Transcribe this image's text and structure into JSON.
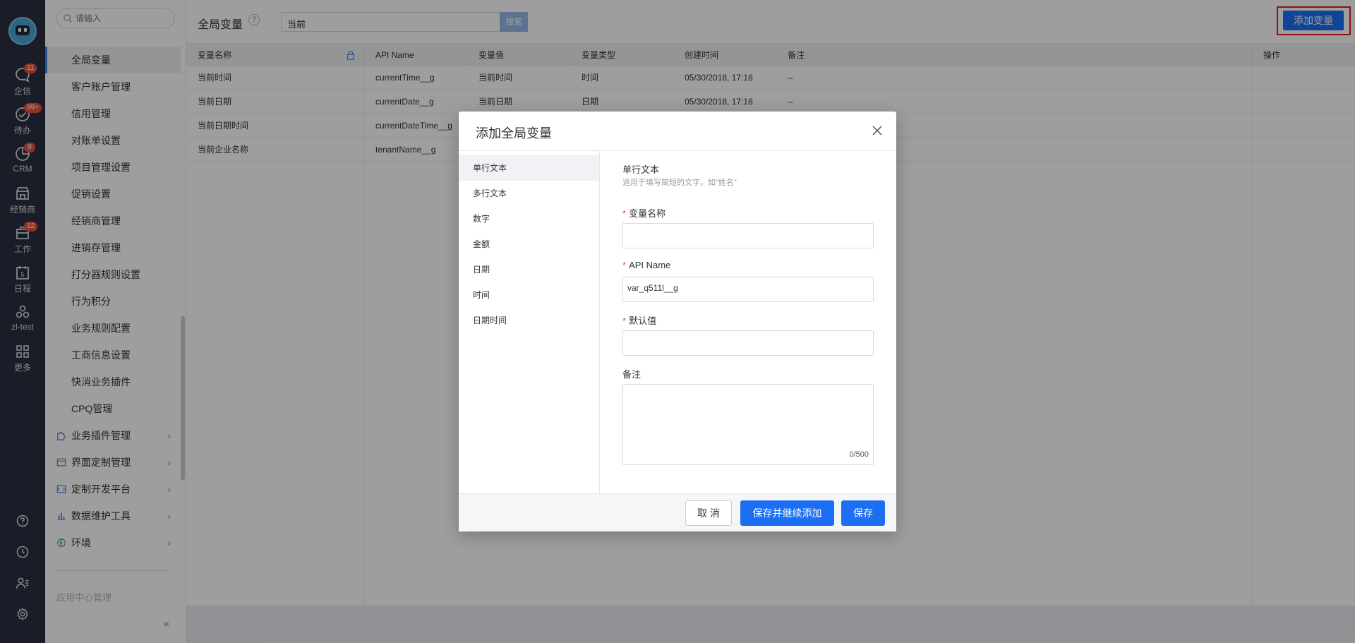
{
  "rail": {
    "items": [
      {
        "label": "企信",
        "badge": "11"
      },
      {
        "label": "待办",
        "badge": "99+"
      },
      {
        "label": "CRM",
        "badge": "9"
      },
      {
        "label": "经销商",
        "badge": ""
      },
      {
        "label": "工作",
        "badge": "12"
      },
      {
        "label": "日程",
        "badge": ""
      },
      {
        "label": "zl-test",
        "badge": ""
      },
      {
        "label": "更多",
        "badge": ""
      }
    ],
    "calendar_day": "5"
  },
  "menu": {
    "search_placeholder": "请输入",
    "items": [
      "全局变量",
      "客户账户管理",
      "信用管理",
      "对账单设置",
      "项目管理设置",
      "促销设置",
      "经销商管理",
      "进销存管理",
      "打分器规则设置",
      "行为积分",
      "业务规则配置",
      "工商信息设置",
      "快消业务插件",
      "CPQ管理"
    ],
    "groups": [
      "业务插件管理",
      "界面定制管理",
      "定制开发平台",
      "数据维护工具",
      "环境"
    ],
    "section": "应用中心管理",
    "collapse": "«"
  },
  "header": {
    "title": "全局变量",
    "help": "?",
    "search_value": "当前",
    "search_button": "搜索",
    "add_button": "添加变量"
  },
  "table": {
    "columns": [
      "变量名称",
      "API Name",
      "变量值",
      "变量类型",
      "创建时间",
      "备注",
      "操作"
    ],
    "rows": [
      [
        "当前时间",
        "currentTime__g",
        "当前时间",
        "时间",
        "05/30/2018, 17:16",
        "--"
      ],
      [
        "当前日期",
        "currentDate__g",
        "当前日期",
        "日期",
        "05/30/2018, 17:16",
        "--"
      ],
      [
        "当前日期时间",
        "currentDateTime__g",
        "",
        "",
        "",
        ""
      ],
      [
        "当前企业名称",
        "tenantName__g",
        "",
        "",
        "",
        ""
      ]
    ]
  },
  "dialog": {
    "title": "添加全局变量",
    "types": [
      "单行文本",
      "多行文本",
      "数字",
      "金额",
      "日期",
      "时间",
      "日期时间"
    ],
    "selected_type": "单行文本",
    "section_title": "单行文本",
    "section_desc": "适用于填写简短的文字，如\"姓名\"",
    "fields": {
      "name_label": "变量名称",
      "name_value": "",
      "api_label": "API Name",
      "api_value": "var_q511l__g",
      "default_label": "默认值",
      "default_value": "",
      "remark_label": "备注",
      "remark_count": "0/500"
    },
    "buttons": {
      "cancel": "取 消",
      "save_and_add": "保存并继续添加",
      "save": "保存"
    }
  },
  "colors": {
    "rail_bg": "#2b3040",
    "primary": "#1c6ff3",
    "badge": "#e8523f",
    "highlight": "#e02020"
  }
}
